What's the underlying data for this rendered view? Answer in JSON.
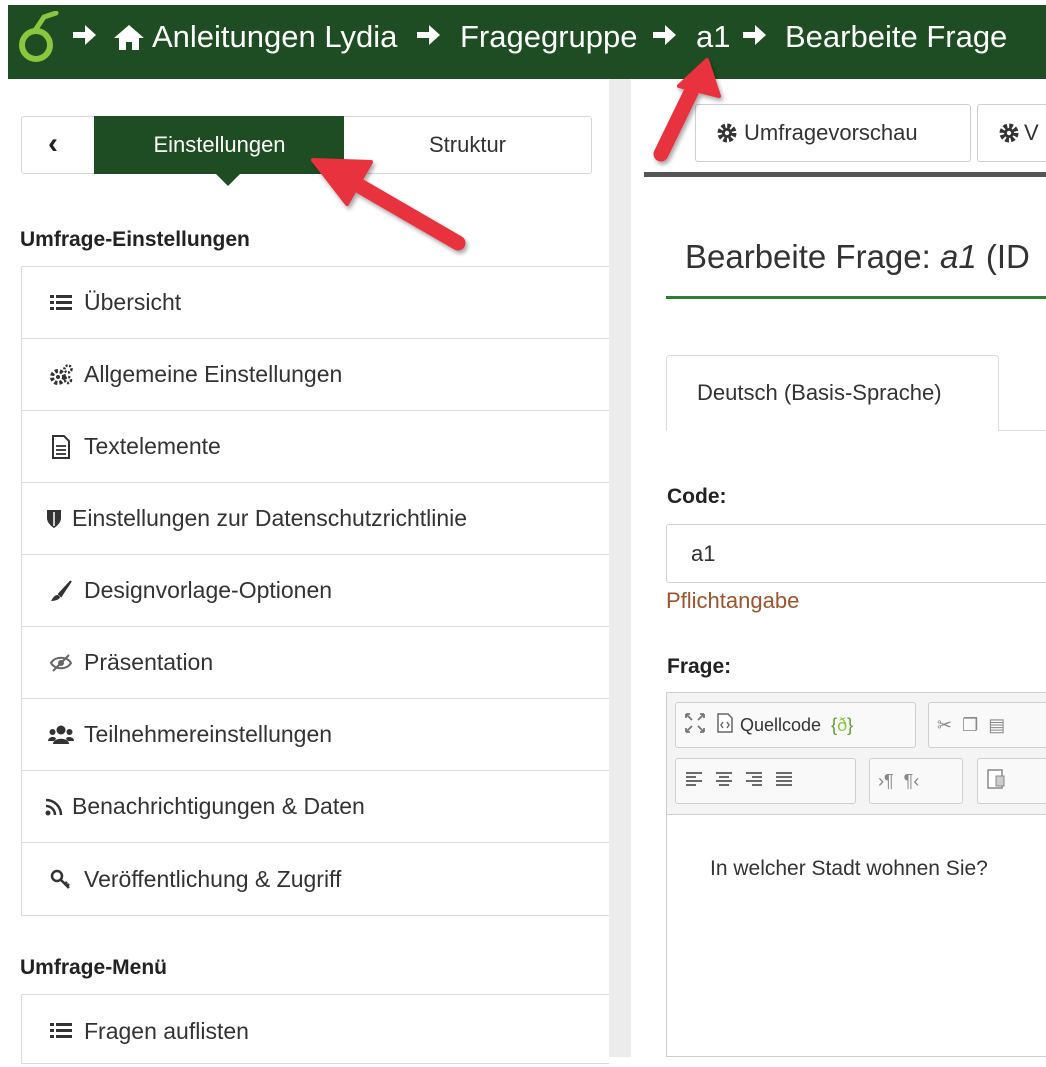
{
  "topbar": {
    "crumbs": [
      "Anleitungen Lydia",
      "Fragegruppe",
      "a1",
      "Bearbeite Frage"
    ],
    "logo_icon": "limesurvey-logo-icon",
    "home_icon": "home-icon",
    "separator_icon": "arrow-right-icon",
    "background": "#1f4d23"
  },
  "left_panel": {
    "back_icon": "chevron-left-icon",
    "tabs": [
      {
        "label": "Einstellungen",
        "active": true
      },
      {
        "label": "Struktur",
        "active": false
      }
    ],
    "sections": [
      {
        "title": "Umfrage-Einstellungen",
        "items": [
          {
            "label": "Übersicht",
            "icon": "list-icon"
          },
          {
            "label": "Allgemeine Einstellungen",
            "icon": "cogs-icon"
          },
          {
            "label": "Textelemente",
            "icon": "file-text-icon"
          },
          {
            "label": "Einstellungen zur Datenschutzrichtlinie",
            "icon": "shield-icon"
          },
          {
            "label": "Designvorlage-Optionen",
            "icon": "paintbrush-icon"
          },
          {
            "label": "Präsentation",
            "icon": "eye-slash-icon"
          },
          {
            "label": "Teilnehmereinstellungen",
            "icon": "users-icon"
          },
          {
            "label": "Benachrichtigungen & Daten",
            "icon": "rss-icon"
          },
          {
            "label": "Veröffentlichung & Zugriff",
            "icon": "key-icon"
          }
        ]
      },
      {
        "title": "Umfrage-Menü",
        "items": [
          {
            "label": "Fragen auflisten",
            "icon": "list-icon"
          }
        ]
      }
    ]
  },
  "right_panel": {
    "toolbar": {
      "preview_label": "Umfragevorschau",
      "second_label": "V",
      "gear_icon": "gear-icon"
    },
    "page_title_prefix": "Bearbeite Frage: ",
    "page_title_code": "a1",
    "page_title_suffix": " (ID",
    "language_tab": "Deutsch (Basis-Sprache)",
    "code_label": "Code:",
    "code_value": "a1",
    "required_text": "Pflichtangabe",
    "question_label": "Frage:",
    "editor": {
      "source_label": "Quellcode",
      "content": "In welcher Stadt wohnen Sie?"
    }
  },
  "colors": {
    "brand_green": "#1f4d23",
    "accent_green": "#2d7d33",
    "annotation_red": "#e8323c",
    "required_text": "#a0522d"
  }
}
